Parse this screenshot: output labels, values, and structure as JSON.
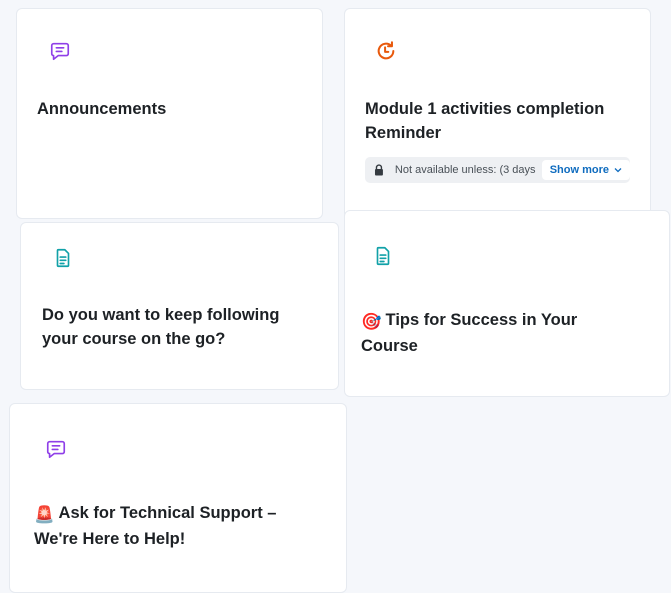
{
  "colors": {
    "forum_icon": "#8f3fe8",
    "page_icon": "#11a1a8",
    "reminder_icon": "#e8590c",
    "link": "#0f6cbf"
  },
  "cards": [
    {
      "title": "Announcements",
      "icon": "forum-icon"
    },
    {
      "title": "Module 1 activities completion Reminder",
      "icon": "clock-reminder-icon",
      "restriction": {
        "text": "Not available unless: (3 days ...",
        "button": "Show more"
      }
    },
    {
      "title": "Do you want to keep following your course on the go?",
      "icon": "page-icon"
    },
    {
      "title": "Tips for Success in Your Course",
      "emoji": "🎯",
      "icon": "page-icon"
    },
    {
      "title": "Ask for Technical Support – We're Here to Help!",
      "emoji": "🚨",
      "icon": "forum-icon"
    }
  ]
}
